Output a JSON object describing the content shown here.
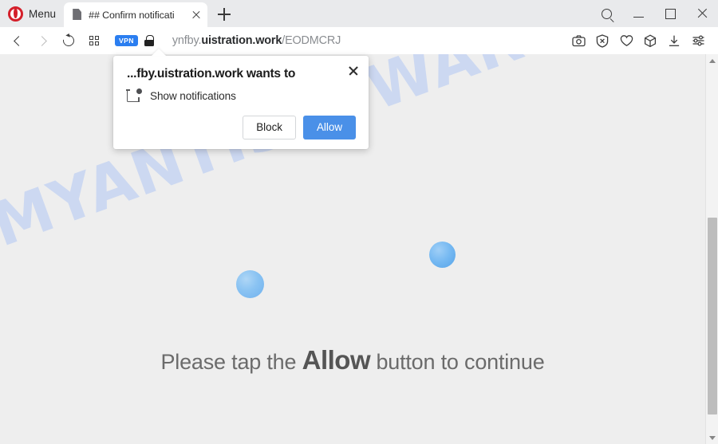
{
  "browser": {
    "name": "Opera",
    "menu_label": "Menu",
    "tabs": [
      {
        "title": "## Confirm notificati",
        "favicon": "page-icon",
        "close_label": "×",
        "active": true
      }
    ],
    "new_tab_label": "+",
    "window_controls": [
      {
        "name": "search-icon",
        "label": "Search"
      },
      {
        "name": "minimize-icon",
        "label": "Minimize"
      },
      {
        "name": "maximize-icon",
        "label": "Maximize"
      },
      {
        "name": "close-icon",
        "label": "Close"
      }
    ],
    "navigation": [
      {
        "name": "back-button",
        "label": "Back",
        "enabled": true
      },
      {
        "name": "forward-button",
        "label": "Forward",
        "enabled": false
      },
      {
        "name": "reload-button",
        "label": "Reload",
        "enabled": true
      },
      {
        "name": "speed-dial-button",
        "label": "Speed Dial",
        "enabled": true
      }
    ],
    "address_bar": {
      "vpn_badge": "VPN",
      "security_icon": "lock-icon",
      "url_prefix": "ynfby.",
      "url_domain": "uistration.work",
      "url_path": "/EODMCRJ",
      "full_url": "ynfby.uistration.work/EODMCRJ"
    },
    "toolbar_icons": [
      {
        "name": "snapshot-icon",
        "label": "Snapshot"
      },
      {
        "name": "ad-blocker-icon",
        "label": "Ad blocker"
      },
      {
        "name": "heart-icon",
        "label": "Favorites"
      },
      {
        "name": "crypto-wallet-icon",
        "label": "Crypto Wallet"
      },
      {
        "name": "downloads-icon",
        "label": "Downloads"
      },
      {
        "name": "easy-setup-icon",
        "label": "Easy setup"
      }
    ]
  },
  "permission_dialog": {
    "title": "...fby.uistration.work wants to",
    "permission_label": "Show notifications",
    "permission_icon": "notification-badge-icon",
    "block_label": "Block",
    "allow_label": "Allow",
    "close_label": "×"
  },
  "page": {
    "watermark": "MYANTISPYWARE.COM",
    "message_before": "Please tap the",
    "message_highlight": "Allow",
    "message_after": "button to continue",
    "loading_dots": 2
  },
  "colors": {
    "allow_button": "#4a90e8",
    "vpn_badge": "#2b7ef0",
    "opera_red": "#d41f2a",
    "watermark": "#c8d6f2",
    "page_background": "#eeeeee"
  }
}
